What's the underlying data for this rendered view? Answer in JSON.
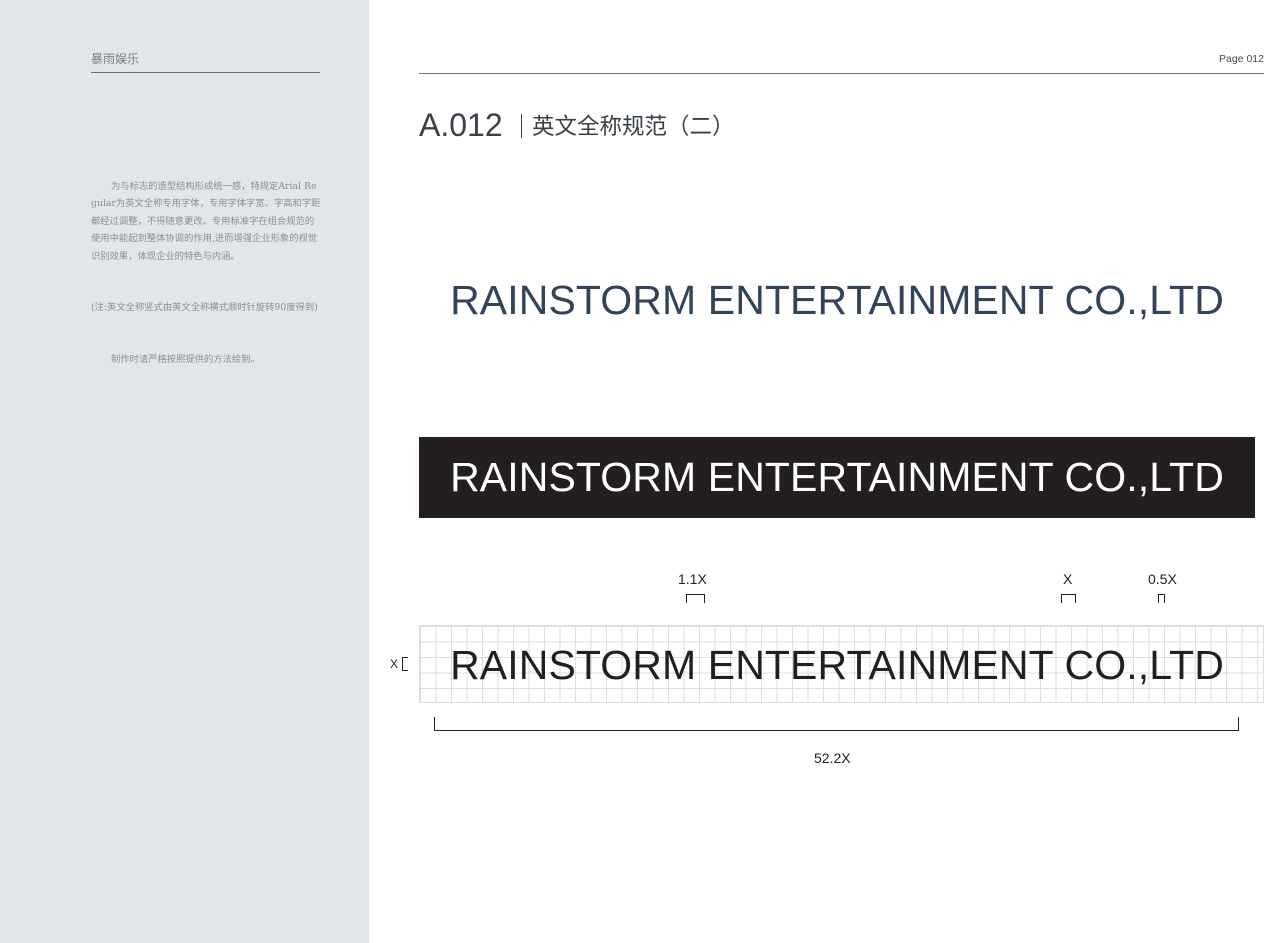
{
  "sidebar": {
    "brand": "暴雨娱乐",
    "paragraphs": [
      "为与标志的造型结构形成统一感，特规定Arial Regular为英文全称专用字体，专用字体字宽、字高和字距都经过调整，不得随意更改。专用标准字在组合规范的使用中能起到整体协调的作用,进而增强企业形象的视觉识别效果，体现企业的特色与内涵。",
      "(注:英文全称竖式由英文全称横式顺时针旋转90度得到)",
      "制作时请严格按照提供的方法绘制。"
    ]
  },
  "header": {
    "page": "Page 012",
    "section_code": "A.012",
    "section_title": "英文全称规范（二）"
  },
  "logo_text": "RAINSTORM ENTERTAINMENT CO.,LTD",
  "colors": {
    "sidebar_bg": "#e1e6ea",
    "logo_blue": "#33435a",
    "band_black": "#231f20",
    "grid_line": "#dedede"
  },
  "dimensions": {
    "letter_spacing_label": "1.1X",
    "word_spacing_label": "X",
    "char_gap_label": "0.5X",
    "height_label": "X",
    "total_width_label": "52.2X"
  }
}
